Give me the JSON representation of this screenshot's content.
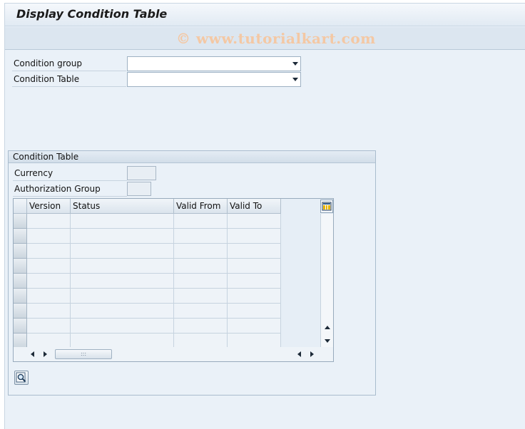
{
  "window": {
    "title": "Display Condition Table",
    "watermark": "© www.tutorialkart.com"
  },
  "selection": {
    "condition_group_label": "Condition group",
    "condition_group_value": "",
    "condition_table_label": "Condition Table",
    "condition_table_value": ""
  },
  "group": {
    "title": "Condition Table",
    "currency_label": "Currency",
    "currency_value": "",
    "auth_group_label": "Authorization Group",
    "auth_group_value": ""
  },
  "table": {
    "columns": [
      "Version",
      "Status",
      "Valid From",
      "Valid To"
    ],
    "visible_rows": 9,
    "rows": []
  },
  "icons": {
    "dropdown": "chevron-down-icon",
    "layout": "table-settings-icon",
    "find": "find-icon",
    "scroll_left": "arrow-left-icon",
    "scroll_right": "arrow-right-icon",
    "scroll_up": "arrow-up-icon",
    "scroll_down": "arrow-down-icon"
  }
}
